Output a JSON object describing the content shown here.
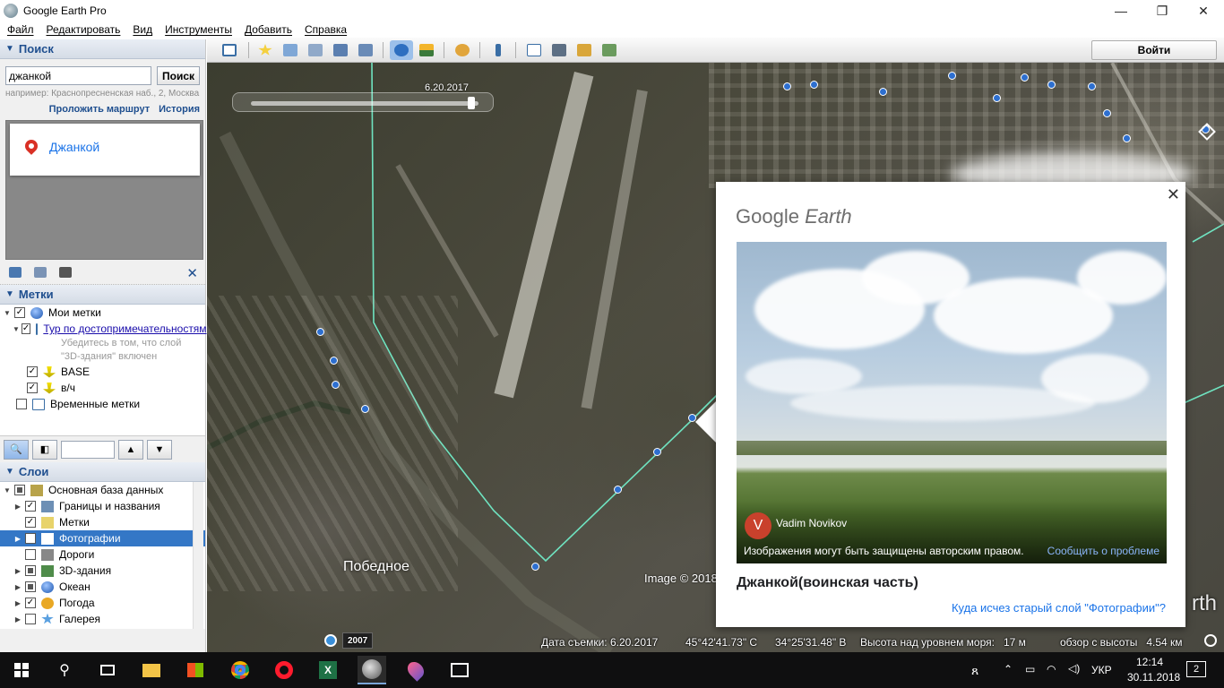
{
  "window": {
    "title": "Google Earth Pro"
  },
  "menu": [
    "Файл",
    "Редактировать",
    "Вид",
    "Инструменты",
    "Добавить",
    "Справка"
  ],
  "search": {
    "header": "Поиск",
    "value": "джанкой",
    "button": "Поиск",
    "hint": "например: Краснопресненская наб., 2, Москва",
    "directions_link": "Проложить маршрут",
    "history_link": "История",
    "result": "Джанкой"
  },
  "places": {
    "header": "Метки",
    "items": [
      {
        "label": "Мои метки"
      },
      {
        "label": "Тур по достопримечательностям"
      },
      {
        "label": "BASE"
      },
      {
        "label": "в/ч"
      },
      {
        "label": "Временные метки"
      }
    ],
    "tour_hint_1": "Убедитесь в том, что слой",
    "tour_hint_2": "\"3D-здания\" включен"
  },
  "layers": {
    "header": "Слои",
    "items": [
      {
        "label": "Основная база данных"
      },
      {
        "label": "Границы и названия"
      },
      {
        "label": "Метки"
      },
      {
        "label": "Фотографии",
        "selected": true
      },
      {
        "label": "Дороги"
      },
      {
        "label": "3D-здания"
      },
      {
        "label": "Океан"
      },
      {
        "label": "Погода"
      },
      {
        "label": "Галерея"
      }
    ]
  },
  "toolbar": {
    "signin": "Войти"
  },
  "map": {
    "timeslider_date": "6.20.2017",
    "town_label": "Победное",
    "image_credit": "Image © 2018",
    "city_label_partial": "rth"
  },
  "popup": {
    "brand_1": "Google",
    "brand_2": "Earth",
    "author_initial": "V",
    "author": "Vadim Novikov",
    "copyright": "Изображения могут быть защищены авторским правом.",
    "report": "Сообщить о проблеме",
    "title": "Джанкой(воинская часть)",
    "link": "Куда исчез старый слой \"Фотографии\"?"
  },
  "status": {
    "year": "2007",
    "date": "Дата съемки: 6.20.2017",
    "lat": "45°42'41.73\" С",
    "lon": "34°25'31.48\" В",
    "elev": "Высота над уровнем моря:   17 м",
    "eye": "обзор с высоты   4.54 км"
  },
  "taskbar": {
    "lang": "УКР",
    "time": "12:14",
    "date": "30.11.2018",
    "notifications": "2"
  }
}
